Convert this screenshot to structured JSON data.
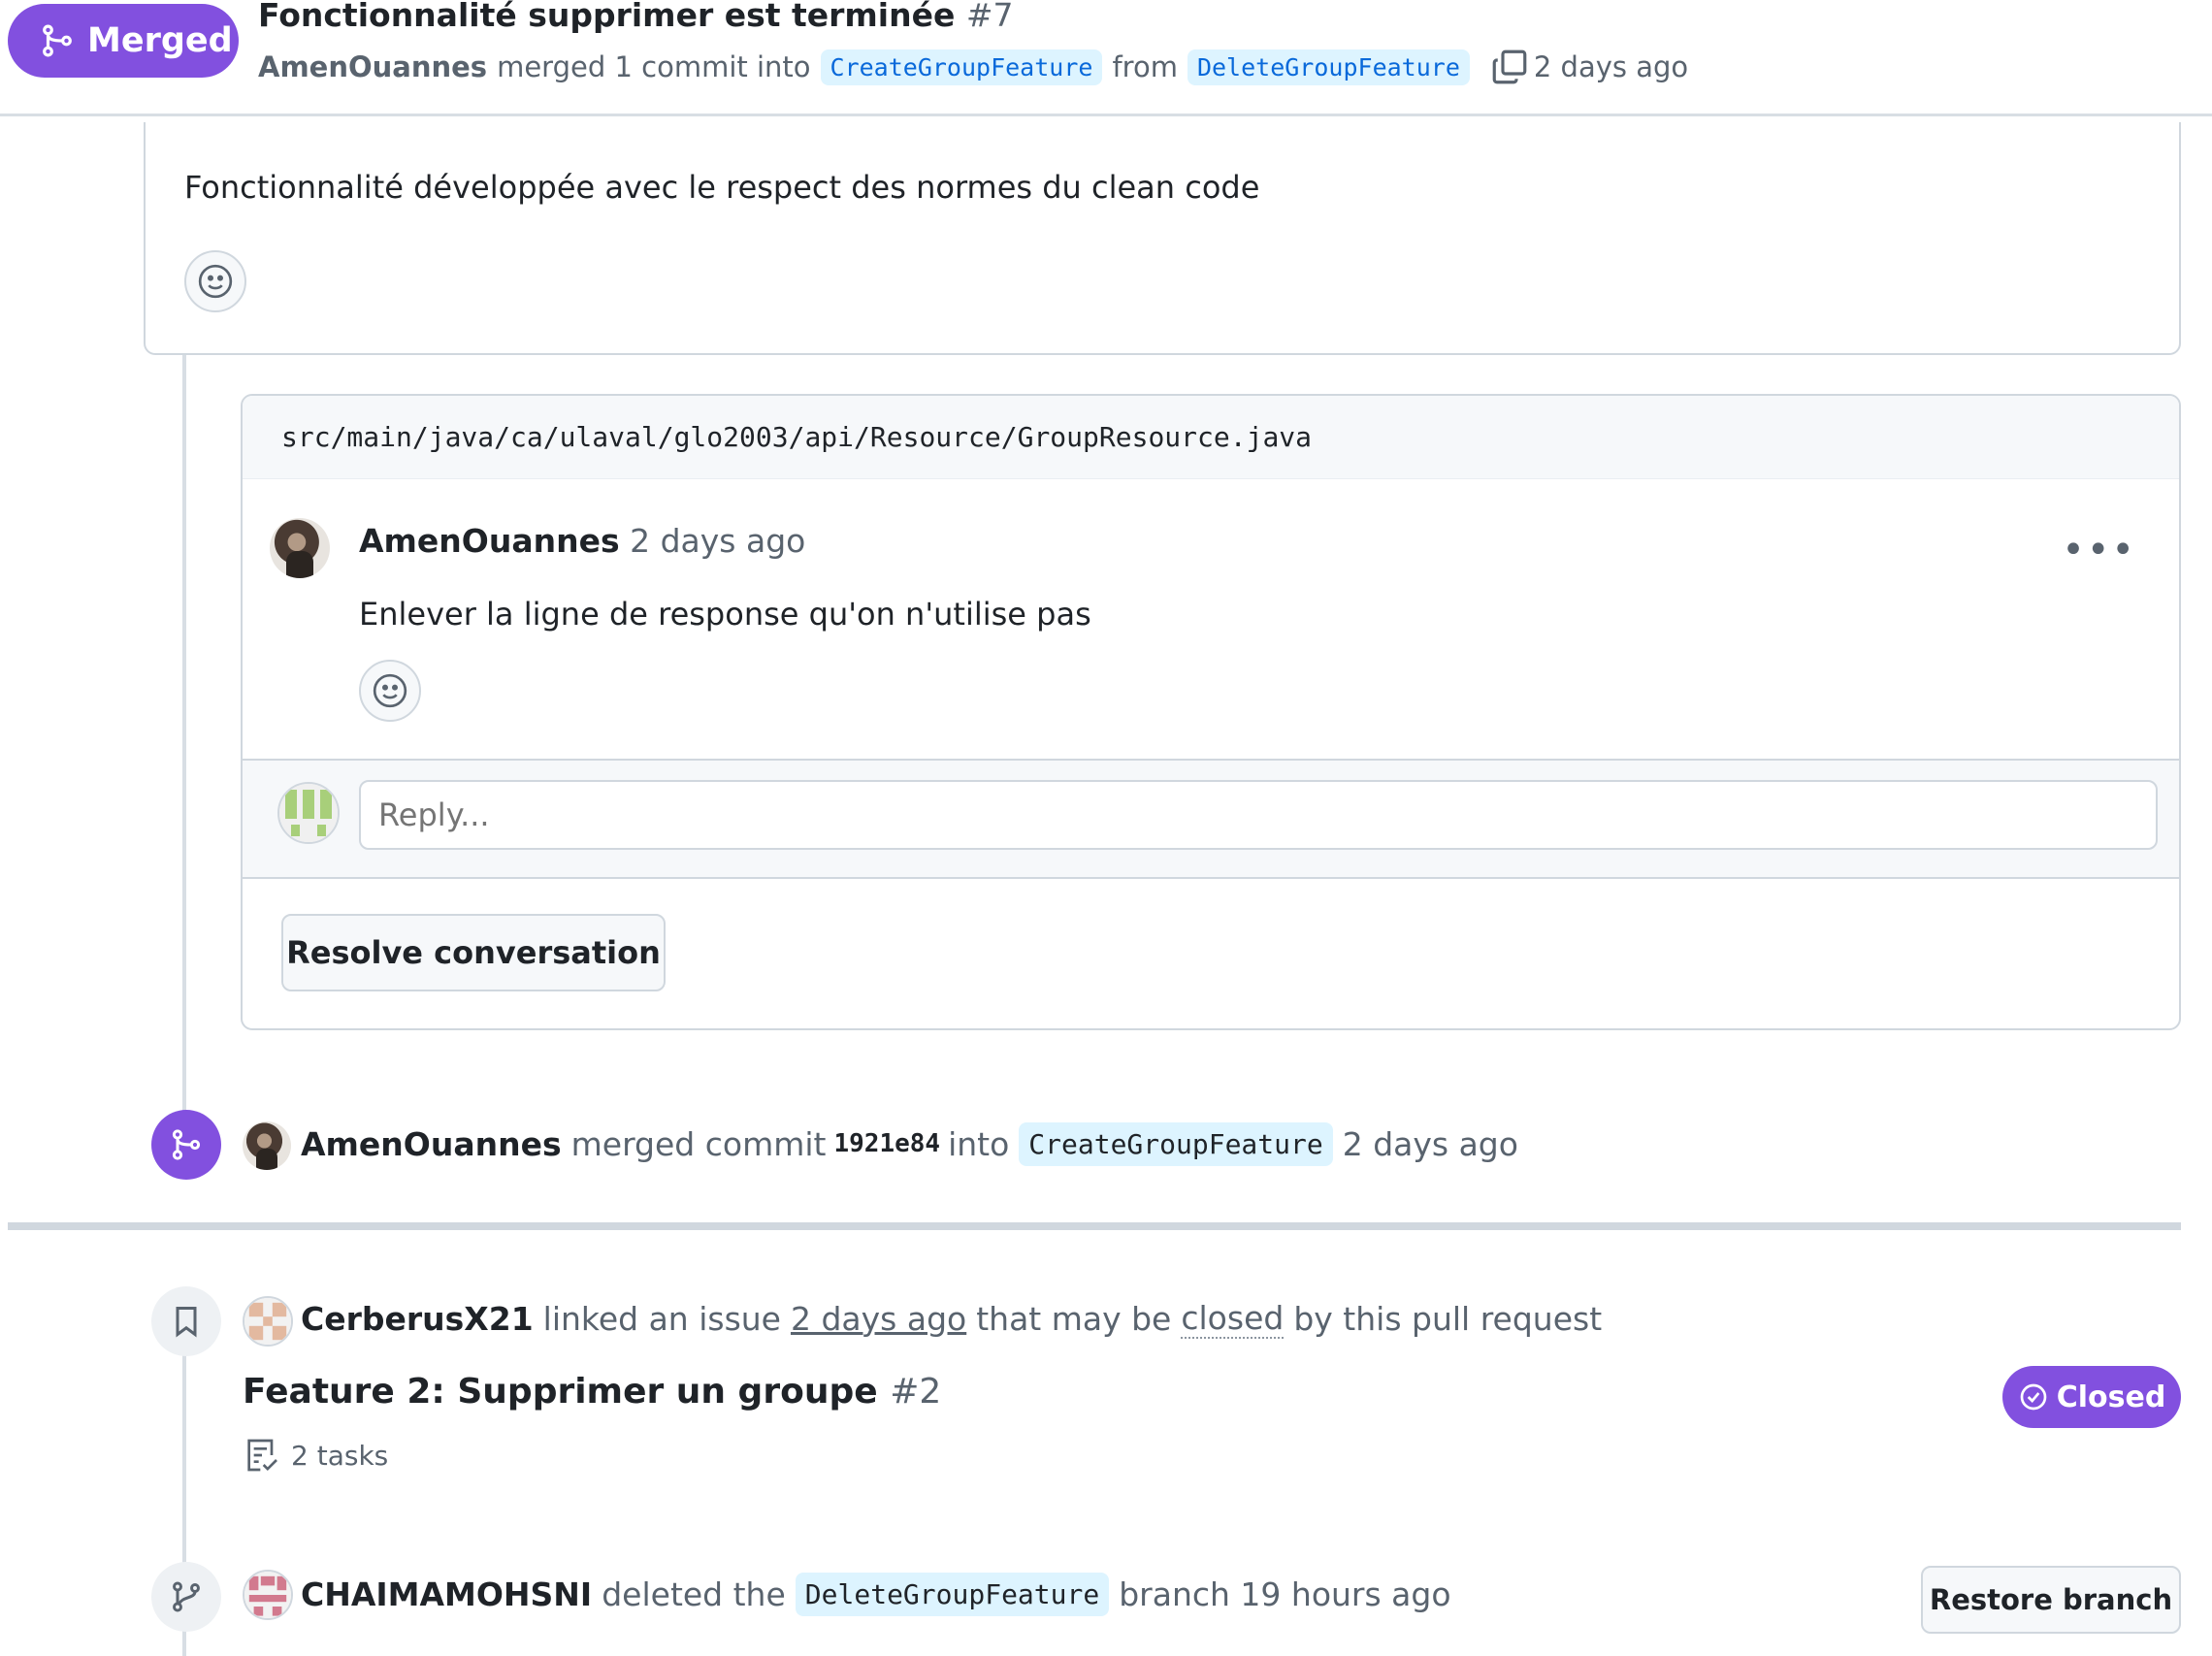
{
  "header": {
    "status": "Merged",
    "title": "Fonctionnalité supprimer est terminée",
    "number": "#7",
    "author": "AmenOuannes",
    "merged_text": "merged 1 commit into",
    "base_branch": "CreateGroupFeature",
    "from_text": "from",
    "head_branch": "DeleteGroupFeature",
    "time": "2 days ago"
  },
  "description": {
    "text": "Fonctionnalité développée avec le respect des normes du clean code"
  },
  "review_thread": {
    "file_path": "src/main/java/ca/ulaval/glo2003/api/Resource/GroupResource.java",
    "author": "AmenOuannes",
    "time": "2 days ago",
    "body": "Enlever la ligne de response qu'on n'utilise pas",
    "menu": "•••",
    "reply_placeholder": "Reply...",
    "resolve_label": "Resolve conversation"
  },
  "merge_event": {
    "author": "AmenOuannes",
    "text1": "merged commit",
    "sha": "1921e84",
    "text2": "into",
    "branch": "CreateGroupFeature",
    "time": "2 days ago"
  },
  "link_event": {
    "author": "CerberusX21",
    "text1": "linked an issue",
    "time": "2 days ago",
    "text2": "that may be",
    "closed_word": "closed",
    "text3": "by this pull request",
    "issue_title": "Feature 2: Supprimer un groupe",
    "issue_number": "#2",
    "tasks": "2 tasks",
    "status": "Closed"
  },
  "delete_event": {
    "author": "CHAIMAMOHSNI",
    "text1": "deleted the",
    "branch": "DeleteGroupFeature",
    "text2": "branch 19 hours ago",
    "restore_label": "Restore branch"
  },
  "colors": {
    "merged": "#8250df",
    "link": "#0969da",
    "border": "#d0d7de",
    "muted": "#59636e"
  }
}
